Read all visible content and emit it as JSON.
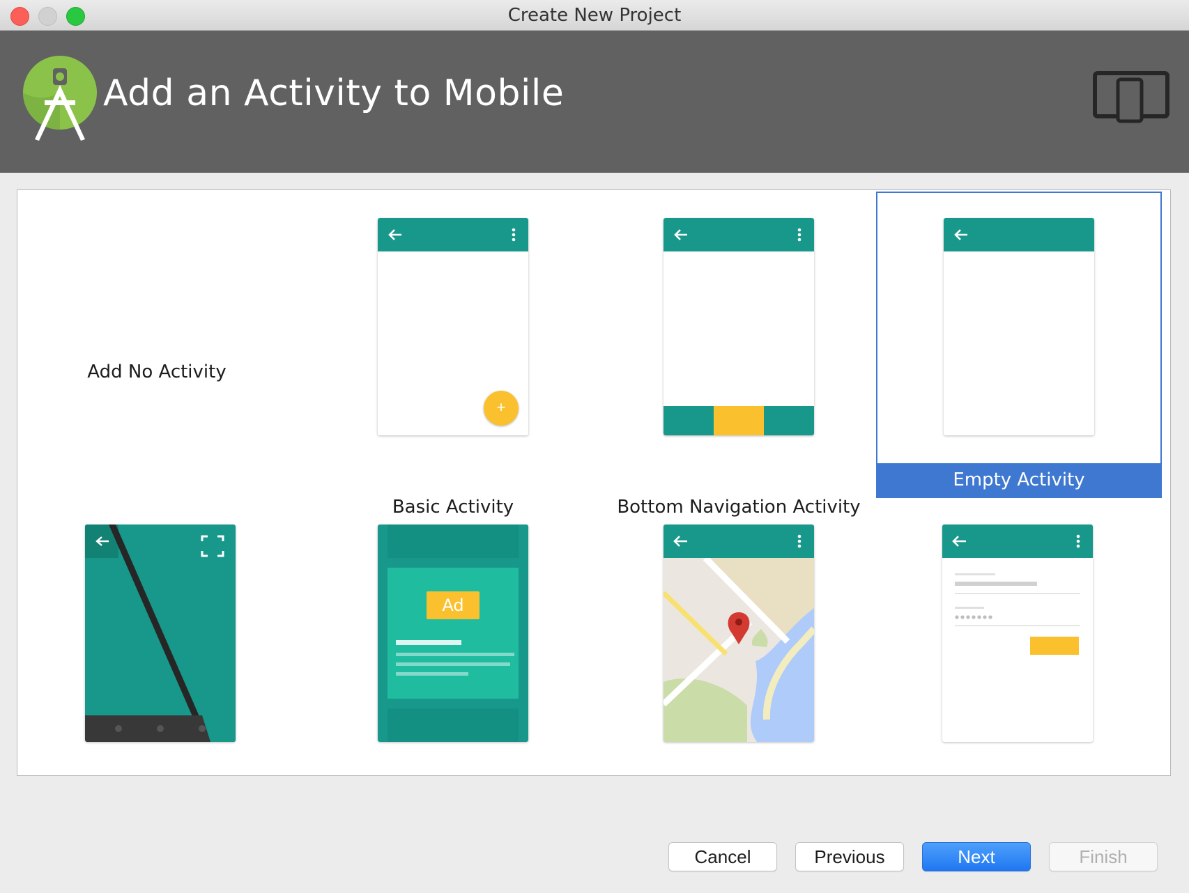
{
  "window": {
    "title": "Create New Project"
  },
  "header": {
    "title": "Add an Activity to Mobile",
    "logo_icon": "android-studio-logo-icon",
    "device_icon": "tablet-phone-icon"
  },
  "gallery": {
    "selected": "Empty Activity",
    "templates": [
      {
        "label": "Add No Activity"
      },
      {
        "label": "Basic Activity"
      },
      {
        "label": "Bottom Navigation Activity"
      },
      {
        "label": "Empty Activity"
      },
      {
        "label": ""
      },
      {
        "label": ""
      },
      {
        "label": ""
      },
      {
        "label": ""
      }
    ],
    "ad_badge": "Ad",
    "fab_symbol": "+"
  },
  "buttons": {
    "cancel": "Cancel",
    "previous": "Previous",
    "next": "Next",
    "finish": "Finish"
  },
  "colors": {
    "accent_teal": "#17988a",
    "accent_yellow": "#fbc02d",
    "selection_blue": "#3f78d1",
    "header_gray": "#616161"
  }
}
